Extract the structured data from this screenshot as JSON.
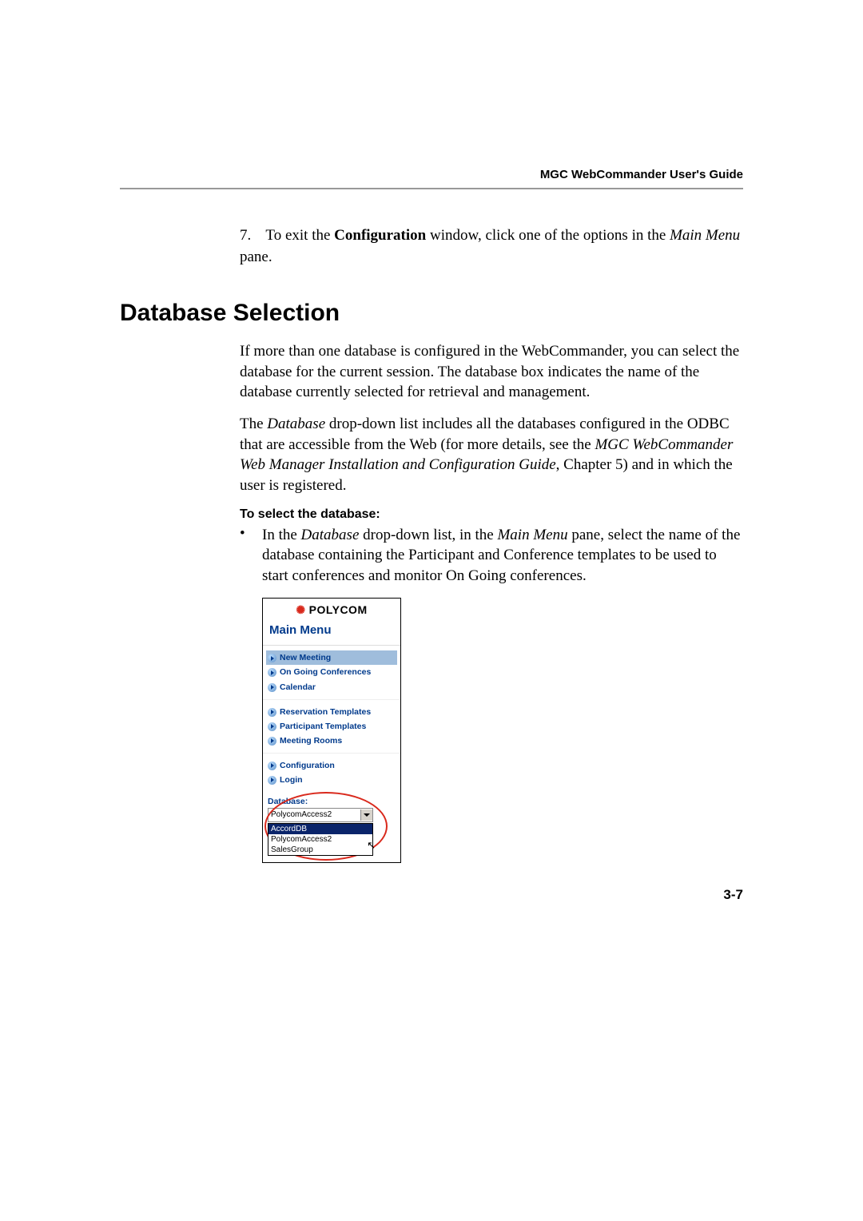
{
  "header": "MGC WebCommander User's Guide",
  "step": {
    "num": "7.",
    "text_before_bold": "To exit the ",
    "bold1": "Configuration",
    "mid": " window, click one of the options in the ",
    "italic1": "Main Menu",
    "after": " pane."
  },
  "section_title": "Database Selection",
  "p1": "If more than one database is configured in the WebCommander, you can select the database for the current session. The database box indicates the name of the database currently selected for retrieval and management.",
  "p2": {
    "a": "The ",
    "i1": "Database",
    "b": " drop-down list includes all the databases configured in the ODBC that are accessible from the Web (for more details, see the ",
    "i2": "MGC WebCommander Web Manager Installation and Configuration Guide",
    "c": ", Chapter 5) and in which the user is registered."
  },
  "subhead": "To select the database:",
  "bullet": {
    "a": "In the ",
    "i1": "Database",
    "b": " drop-down list, in the ",
    "i2": "Main Menu",
    "c": " pane, select the name of the database containing the Participant and Conference templates to be used to start conferences and monitor On Going conferences."
  },
  "screenshot": {
    "brand": "POLYCOM",
    "main_menu": "Main Menu",
    "items": {
      "new_meeting": "New Meeting",
      "ongoing": "On Going Conferences",
      "calendar": "Calendar",
      "res_templates": "Reservation Templates",
      "part_templates": "Participant Templates",
      "meeting_rooms": "Meeting Rooms",
      "configuration": "Configuration",
      "login": "Login"
    },
    "db_label": "Database:",
    "db_selected": "PolycomAccess2",
    "db_options": [
      "AccordDB",
      "PolycomAccess2",
      "SalesGroup"
    ]
  },
  "page_number": "3-7"
}
